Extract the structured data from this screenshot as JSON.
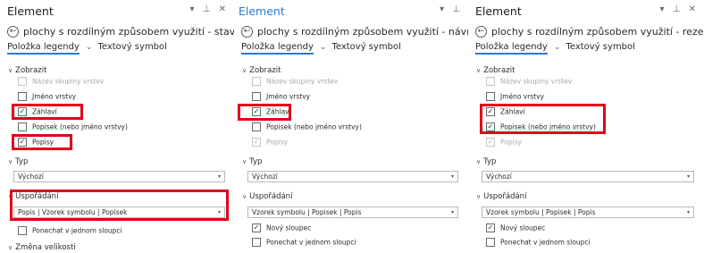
{
  "panels": [
    {
      "title": "Element",
      "header_icons": "▾ ⊥ ✕",
      "layer_name": "plochy s rozdílným způsobem využití - stav",
      "tabs": {
        "legend": "Položka legendy",
        "text_symbol": "Textový symbol"
      },
      "show": {
        "heading": "Zobrazit",
        "items": [
          {
            "label": "Název skupiny vrstev",
            "checked": false,
            "disabled": true
          },
          {
            "label": "Jméno vrstvy",
            "checked": false,
            "disabled": false
          },
          {
            "label": "Záhlaví",
            "checked": true,
            "disabled": false
          },
          {
            "label": "Popisek (nebo jméno vrstvy)",
            "checked": false,
            "disabled": false
          },
          {
            "label": "Popisy",
            "checked": true,
            "disabled": false
          }
        ]
      },
      "type": {
        "heading": "Typ",
        "value": "Výchozí"
      },
      "arrangement": {
        "heading": "Uspořádání",
        "value": "Popis | Vzorek symbolu | Popisek",
        "options": [
          {
            "label": "Ponechat v jednom sloupci",
            "checked": false
          }
        ]
      },
      "resize": {
        "heading": "Změna velikosti"
      }
    },
    {
      "title": "Element",
      "header_icons": "▾ ⊥",
      "layer_name": "plochy s rozdílným způsobem využití - návrh",
      "tabs": {
        "legend": "Položka legendy",
        "text_symbol": "Textový symbol"
      },
      "show": {
        "heading": "Zobrazit",
        "items": [
          {
            "label": "Název skupiny vrstev",
            "checked": false,
            "disabled": true
          },
          {
            "label": "Jméno vrstvy",
            "checked": false,
            "disabled": false
          },
          {
            "label": "Záhlaví",
            "checked": true,
            "disabled": false
          },
          {
            "label": "Popisek (nebo jméno vrstvy)",
            "checked": false,
            "disabled": false
          },
          {
            "label": "Popisy",
            "checked": true,
            "disabled": true
          }
        ]
      },
      "type": {
        "heading": "Typ",
        "value": "Výchozí"
      },
      "arrangement": {
        "heading": "Uspořádání",
        "value": "Vzorek symbolu | Popisek | Popis",
        "options": [
          {
            "label": "Nový sloupec",
            "checked": true
          },
          {
            "label": "Ponechat v jednom sloupci",
            "checked": false
          }
        ]
      }
    },
    {
      "title": "Element",
      "header_icons": "▾ ⊥ ✕",
      "layer_name": "plochy s rozdílným způsobem využití - rezerva",
      "tabs": {
        "legend": "Položka legendy",
        "text_symbol": "Textový symbol"
      },
      "show": {
        "heading": "Zobrazit",
        "items": [
          {
            "label": "Název skupiny vrstev",
            "checked": false,
            "disabled": true
          },
          {
            "label": "Jméno vrstvy",
            "checked": false,
            "disabled": false
          },
          {
            "label": "Záhlaví",
            "checked": true,
            "disabled": false
          },
          {
            "label": "Popisek (nebo jméno vrstvy)",
            "checked": true,
            "disabled": false
          },
          {
            "label": "Popisy",
            "checked": true,
            "disabled": true
          }
        ]
      },
      "type": {
        "heading": "Typ",
        "value": "Výchozí"
      },
      "arrangement": {
        "heading": "Uspořádání",
        "value": "Vzorek symbolu | Popisek | Popis",
        "options": [
          {
            "label": "Nový sloupec",
            "checked": true
          },
          {
            "label": "Ponechat v jednom sloupci",
            "checked": false
          }
        ]
      }
    }
  ],
  "highlight_color": "#e0001b",
  "link_color": "#2b7ad7"
}
